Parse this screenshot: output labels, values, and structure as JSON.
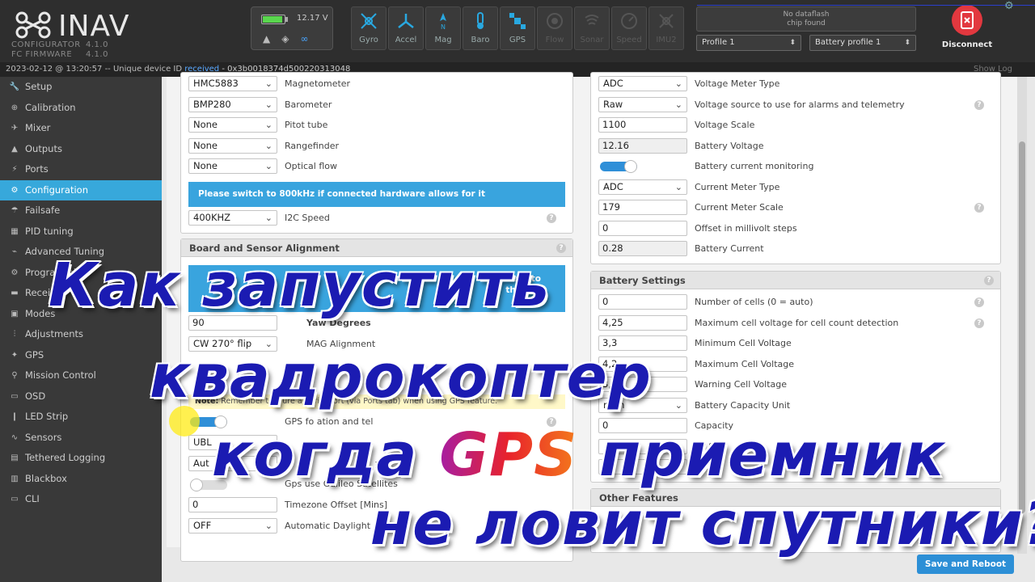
{
  "app": {
    "logo": "INAV",
    "configurator_label": "CONFIGURATOR",
    "configurator_version": "4.1.0",
    "firmware_label": "FC FIRMWARE",
    "firmware_version": "4.1.0",
    "battery_voltage": "12.17 V",
    "battery_level": 0.85
  },
  "sensors": [
    {
      "label": "Gyro",
      "icon": "gyro-icon",
      "active": true
    },
    {
      "label": "Accel",
      "icon": "accel-icon",
      "active": true
    },
    {
      "label": "Mag",
      "icon": "mag-icon",
      "active": true
    },
    {
      "label": "Baro",
      "icon": "baro-icon",
      "active": true
    },
    {
      "label": "GPS",
      "icon": "gps-icon",
      "active": true
    },
    {
      "label": "Flow",
      "icon": "flow-icon",
      "active": false
    },
    {
      "label": "Sonar",
      "icon": "sonar-icon",
      "active": false
    },
    {
      "label": "Speed",
      "icon": "speed-icon",
      "active": false
    },
    {
      "label": "IMU2",
      "icon": "imu2-icon",
      "active": false
    }
  ],
  "dataflash": {
    "line1": "No dataflash",
    "line2": "chip found"
  },
  "profiles": {
    "profile": "Profile 1",
    "battery_profile": "Battery profile 1"
  },
  "disconnect_label": "Disconnect",
  "statusbar": {
    "prefix": "2023-02-12 @ 13:20:57 -- Unique device ID ",
    "received": "received",
    "device_id": " - 0x3b0018374d500220313048",
    "show_log": "Show Log"
  },
  "sidebar": {
    "items": [
      {
        "label": "Setup",
        "icon": "wrench-icon",
        "glyph": "🔧"
      },
      {
        "label": "Calibration",
        "icon": "calibration-icon",
        "glyph": "⊕"
      },
      {
        "label": "Mixer",
        "icon": "mixer-icon",
        "glyph": "✈"
      },
      {
        "label": "Outputs",
        "icon": "outputs-icon",
        "glyph": "▲"
      },
      {
        "label": "Ports",
        "icon": "ports-icon",
        "glyph": "⚡"
      },
      {
        "label": "Configuration",
        "icon": "gear-icon",
        "glyph": "⚙",
        "active": true
      },
      {
        "label": "Failsafe",
        "icon": "failsafe-icon",
        "glyph": "☂"
      },
      {
        "label": "PID tuning",
        "icon": "pid-icon",
        "glyph": "▦"
      },
      {
        "label": "Advanced Tuning",
        "icon": "advanced-tuning-icon",
        "glyph": "⌁"
      },
      {
        "label": "Programming",
        "icon": "programming-icon",
        "glyph": "⚙"
      },
      {
        "label": "Receiver",
        "icon": "receiver-icon",
        "glyph": "▬"
      },
      {
        "label": "Modes",
        "icon": "modes-icon",
        "glyph": "▣"
      },
      {
        "label": "Adjustments",
        "icon": "adjustments-icon",
        "glyph": "⫶"
      },
      {
        "label": "GPS",
        "icon": "satellite-icon",
        "glyph": "✦"
      },
      {
        "label": "Mission Control",
        "icon": "map-pin-icon",
        "glyph": "⚲"
      },
      {
        "label": "OSD",
        "icon": "osd-icon",
        "glyph": "▭"
      },
      {
        "label": "LED Strip",
        "icon": "led-icon",
        "glyph": "❙"
      },
      {
        "label": "Sensors",
        "icon": "sensors-icon",
        "glyph": "∿"
      },
      {
        "label": "Tethered Logging",
        "icon": "tethered-icon",
        "glyph": "▤"
      },
      {
        "label": "Blackbox",
        "icon": "blackbox-icon",
        "glyph": "▥"
      },
      {
        "label": "CLI",
        "icon": "cli-icon",
        "glyph": "▭"
      }
    ]
  },
  "left": {
    "rows": [
      {
        "value": "HMC5883",
        "label": "Magnetometer"
      },
      {
        "value": "BMP280",
        "label": "Barometer"
      },
      {
        "value": "None",
        "label": "Pitot tube"
      },
      {
        "value": "None",
        "label": "Rangefinder"
      },
      {
        "value": "None",
        "label": "Optical flow"
      }
    ],
    "i2c_notice": "Please switch to 800kHz if connected hardware allows for it",
    "i2c_value": "400KHZ",
    "i2c_label": "I2C Speed",
    "alignment_title": "Board and Sensor Alignment",
    "alignment_notice_tail1": "use it to",
    "alignment_notice_tail2": "the PID",
    "yaw_value": "90",
    "yaw_label": "Yaw Degrees",
    "mag_align_value": "CW 270° flip",
    "mag_align_label": "MAG Alignment",
    "gps_note_bold": "Note:",
    "gps_note_text": " Remember to c     ure a Serial Port (via Ports tab) when using GPS feature.",
    "gps_toggle_label": "GPS fo    ation and tel",
    "gps_protocol": "UBL",
    "gps_auto": "Aut",
    "gps_auto_label": "ype",
    "galileo_label": "Gps use Galileo Satellites",
    "tz_value": "0",
    "tz_label": "Timezone Offset [Mins]",
    "dst_value": "OFF",
    "dst_label": "Automatic Daylight"
  },
  "right": {
    "rows": [
      {
        "type": "select",
        "value": "ADC",
        "label": "Voltage Meter Type"
      },
      {
        "type": "select",
        "value": "Raw",
        "label": "Voltage source to use for alarms and telemetry",
        "help": true
      },
      {
        "type": "input",
        "value": "1100",
        "label": "Voltage Scale"
      },
      {
        "type": "readonly",
        "value": "12.16",
        "label": "Battery Voltage"
      },
      {
        "type": "toggle",
        "value": "",
        "label": "Battery current monitoring"
      },
      {
        "type": "select",
        "value": "ADC",
        "label": "Current Meter Type"
      },
      {
        "type": "input",
        "value": "179",
        "label": "Current Meter Scale",
        "help": true
      },
      {
        "type": "input",
        "value": "0",
        "label": "Offset in millivolt steps"
      },
      {
        "type": "readonly",
        "value": "0.28",
        "label": "Battery Current"
      }
    ],
    "battery_title": "Battery Settings",
    "battery_rows": [
      {
        "type": "input",
        "value": "0",
        "label": "Number of cells (0 = auto)",
        "help": true
      },
      {
        "type": "input",
        "value": "4,25",
        "label": "Maximum cell voltage for cell count detection",
        "help": true
      },
      {
        "type": "input",
        "value": "3,3",
        "label": "Minimum Cell Voltage"
      },
      {
        "type": "input",
        "value": "4,2",
        "label": "Maximum Cell Voltage"
      },
      {
        "type": "input",
        "value": "3,5",
        "label": "Warning Cell Voltage"
      },
      {
        "type": "select",
        "value": "mAh",
        "label": "Battery Capacity Unit"
      },
      {
        "type": "input",
        "value": "0",
        "label": "Capacity"
      },
      {
        "type": "input",
        "value": "",
        "label": "ng %)"
      },
      {
        "type": "input",
        "value": "",
        "label": "t %)"
      }
    ],
    "other_title": "Other Features"
  },
  "save_label": "Save and Reboot",
  "overlay": {
    "line1": "Как запустить",
    "line2": "квадрокоптер",
    "line3_pre": "когда ",
    "line3_gps": "GPS",
    "line3_post": " приемник",
    "line4": "не ловит спутники?"
  },
  "colors": {
    "accent": "#37a8db",
    "active_nav": "#37a8db",
    "disconnect": "#e2383f"
  }
}
